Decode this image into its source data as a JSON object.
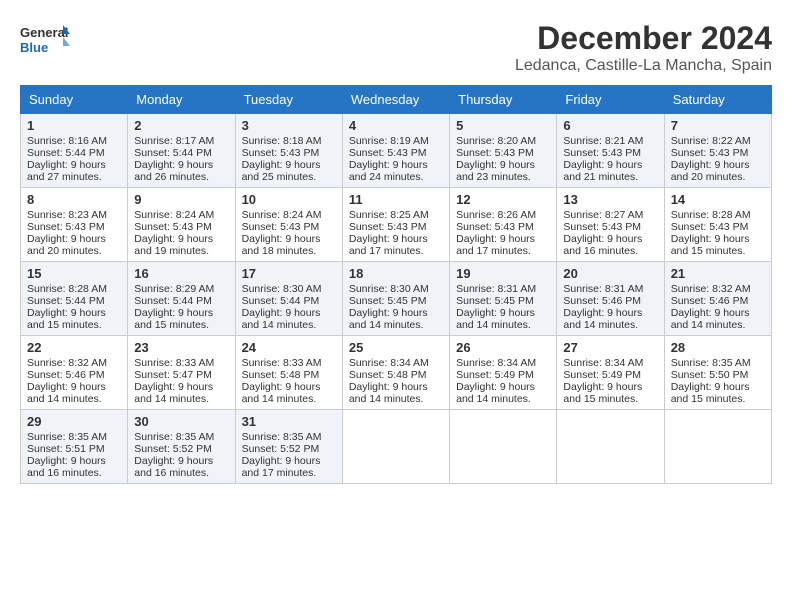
{
  "header": {
    "logo_general": "General",
    "logo_blue": "Blue",
    "main_title": "December 2024",
    "subtitle": "Ledanca, Castille-La Mancha, Spain"
  },
  "calendar": {
    "days_of_week": [
      "Sunday",
      "Monday",
      "Tuesday",
      "Wednesday",
      "Thursday",
      "Friday",
      "Saturday"
    ],
    "weeks": [
      [
        {
          "day": "1",
          "sunrise": "Sunrise: 8:16 AM",
          "sunset": "Sunset: 5:44 PM",
          "daylight": "Daylight: 9 hours and 27 minutes."
        },
        {
          "day": "2",
          "sunrise": "Sunrise: 8:17 AM",
          "sunset": "Sunset: 5:44 PM",
          "daylight": "Daylight: 9 hours and 26 minutes."
        },
        {
          "day": "3",
          "sunrise": "Sunrise: 8:18 AM",
          "sunset": "Sunset: 5:43 PM",
          "daylight": "Daylight: 9 hours and 25 minutes."
        },
        {
          "day": "4",
          "sunrise": "Sunrise: 8:19 AM",
          "sunset": "Sunset: 5:43 PM",
          "daylight": "Daylight: 9 hours and 24 minutes."
        },
        {
          "day": "5",
          "sunrise": "Sunrise: 8:20 AM",
          "sunset": "Sunset: 5:43 PM",
          "daylight": "Daylight: 9 hours and 23 minutes."
        },
        {
          "day": "6",
          "sunrise": "Sunrise: 8:21 AM",
          "sunset": "Sunset: 5:43 PM",
          "daylight": "Daylight: 9 hours and 21 minutes."
        },
        {
          "day": "7",
          "sunrise": "Sunrise: 8:22 AM",
          "sunset": "Sunset: 5:43 PM",
          "daylight": "Daylight: 9 hours and 20 minutes."
        }
      ],
      [
        {
          "day": "8",
          "sunrise": "Sunrise: 8:23 AM",
          "sunset": "Sunset: 5:43 PM",
          "daylight": "Daylight: 9 hours and 20 minutes."
        },
        {
          "day": "9",
          "sunrise": "Sunrise: 8:24 AM",
          "sunset": "Sunset: 5:43 PM",
          "daylight": "Daylight: 9 hours and 19 minutes."
        },
        {
          "day": "10",
          "sunrise": "Sunrise: 8:24 AM",
          "sunset": "Sunset: 5:43 PM",
          "daylight": "Daylight: 9 hours and 18 minutes."
        },
        {
          "day": "11",
          "sunrise": "Sunrise: 8:25 AM",
          "sunset": "Sunset: 5:43 PM",
          "daylight": "Daylight: 9 hours and 17 minutes."
        },
        {
          "day": "12",
          "sunrise": "Sunrise: 8:26 AM",
          "sunset": "Sunset: 5:43 PM",
          "daylight": "Daylight: 9 hours and 17 minutes."
        },
        {
          "day": "13",
          "sunrise": "Sunrise: 8:27 AM",
          "sunset": "Sunset: 5:43 PM",
          "daylight": "Daylight: 9 hours and 16 minutes."
        },
        {
          "day": "14",
          "sunrise": "Sunrise: 8:28 AM",
          "sunset": "Sunset: 5:43 PM",
          "daylight": "Daylight: 9 hours and 15 minutes."
        }
      ],
      [
        {
          "day": "15",
          "sunrise": "Sunrise: 8:28 AM",
          "sunset": "Sunset: 5:44 PM",
          "daylight": "Daylight: 9 hours and 15 minutes."
        },
        {
          "day": "16",
          "sunrise": "Sunrise: 8:29 AM",
          "sunset": "Sunset: 5:44 PM",
          "daylight": "Daylight: 9 hours and 15 minutes."
        },
        {
          "day": "17",
          "sunrise": "Sunrise: 8:30 AM",
          "sunset": "Sunset: 5:44 PM",
          "daylight": "Daylight: 9 hours and 14 minutes."
        },
        {
          "day": "18",
          "sunrise": "Sunrise: 8:30 AM",
          "sunset": "Sunset: 5:45 PM",
          "daylight": "Daylight: 9 hours and 14 minutes."
        },
        {
          "day": "19",
          "sunrise": "Sunrise: 8:31 AM",
          "sunset": "Sunset: 5:45 PM",
          "daylight": "Daylight: 9 hours and 14 minutes."
        },
        {
          "day": "20",
          "sunrise": "Sunrise: 8:31 AM",
          "sunset": "Sunset: 5:46 PM",
          "daylight": "Daylight: 9 hours and 14 minutes."
        },
        {
          "day": "21",
          "sunrise": "Sunrise: 8:32 AM",
          "sunset": "Sunset: 5:46 PM",
          "daylight": "Daylight: 9 hours and 14 minutes."
        }
      ],
      [
        {
          "day": "22",
          "sunrise": "Sunrise: 8:32 AM",
          "sunset": "Sunset: 5:46 PM",
          "daylight": "Daylight: 9 hours and 14 minutes."
        },
        {
          "day": "23",
          "sunrise": "Sunrise: 8:33 AM",
          "sunset": "Sunset: 5:47 PM",
          "daylight": "Daylight: 9 hours and 14 minutes."
        },
        {
          "day": "24",
          "sunrise": "Sunrise: 8:33 AM",
          "sunset": "Sunset: 5:48 PM",
          "daylight": "Daylight: 9 hours and 14 minutes."
        },
        {
          "day": "25",
          "sunrise": "Sunrise: 8:34 AM",
          "sunset": "Sunset: 5:48 PM",
          "daylight": "Daylight: 9 hours and 14 minutes."
        },
        {
          "day": "26",
          "sunrise": "Sunrise: 8:34 AM",
          "sunset": "Sunset: 5:49 PM",
          "daylight": "Daylight: 9 hours and 14 minutes."
        },
        {
          "day": "27",
          "sunrise": "Sunrise: 8:34 AM",
          "sunset": "Sunset: 5:49 PM",
          "daylight": "Daylight: 9 hours and 15 minutes."
        },
        {
          "day": "28",
          "sunrise": "Sunrise: 8:35 AM",
          "sunset": "Sunset: 5:50 PM",
          "daylight": "Daylight: 9 hours and 15 minutes."
        }
      ],
      [
        {
          "day": "29",
          "sunrise": "Sunrise: 8:35 AM",
          "sunset": "Sunset: 5:51 PM",
          "daylight": "Daylight: 9 hours and 16 minutes."
        },
        {
          "day": "30",
          "sunrise": "Sunrise: 8:35 AM",
          "sunset": "Sunset: 5:52 PM",
          "daylight": "Daylight: 9 hours and 16 minutes."
        },
        {
          "day": "31",
          "sunrise": "Sunrise: 8:35 AM",
          "sunset": "Sunset: 5:52 PM",
          "daylight": "Daylight: 9 hours and 17 minutes."
        },
        null,
        null,
        null,
        null
      ]
    ]
  }
}
